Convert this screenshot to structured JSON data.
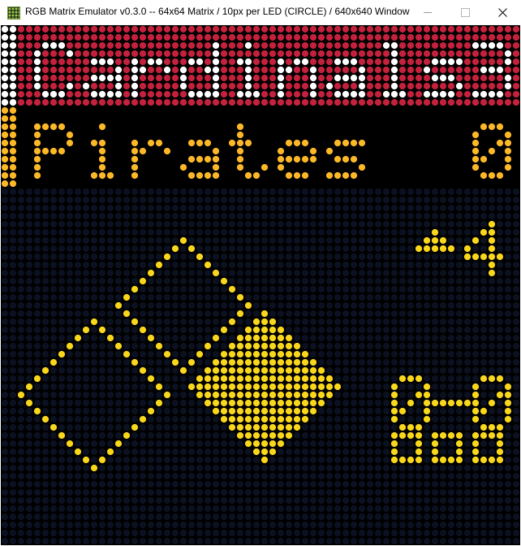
{
  "window": {
    "title": "RGB Matrix Emulator v0.3.0 -- 64x64 Matrix / 10px per LED (CIRCLE) / 640x640 Window",
    "icon": "led-matrix-icon",
    "controls": [
      "minimize",
      "maximize",
      "close"
    ]
  },
  "scoreboard": {
    "away": {
      "name": "Cardinals",
      "runs": "3",
      "bg_color": "#c4213d",
      "text_color": "#ffffff",
      "accent_color": "#ffffff"
    },
    "home": {
      "name": "Pirates",
      "runs": "0",
      "bg_color": "#000000",
      "text_color": "#fdb827",
      "accent_color": "#fdb827"
    },
    "inning": {
      "half": "top",
      "number": "4"
    },
    "count": {
      "balls": "0",
      "strikes": "0"
    },
    "outs": 0,
    "bases": {
      "first": true,
      "second": false,
      "third": false
    },
    "colors": {
      "field_bg": "#0b1120",
      "led_yellow": "#f9d71c",
      "unlit_led": "#111420"
    }
  }
}
